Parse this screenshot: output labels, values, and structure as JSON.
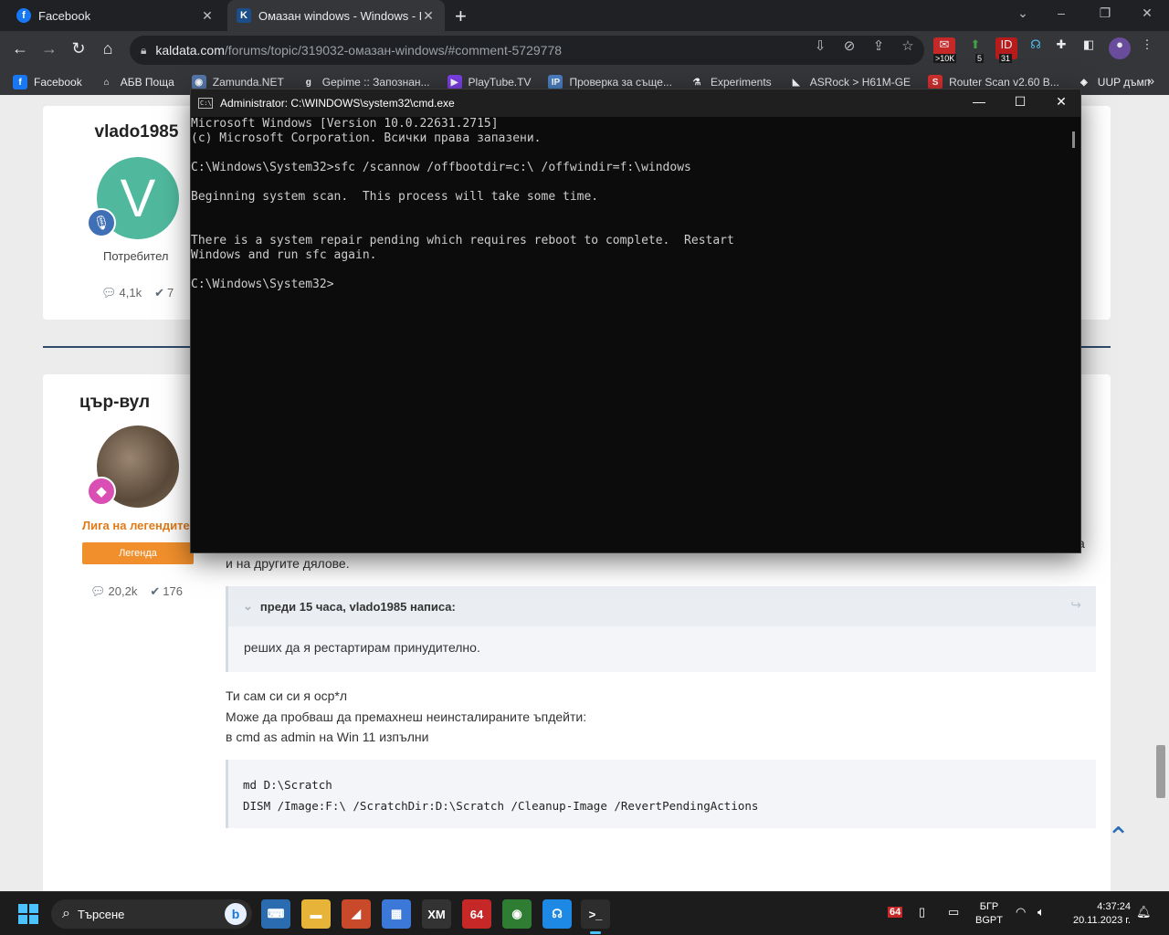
{
  "browser": {
    "tabs": [
      {
        "title": "Facebook",
        "active": false
      },
      {
        "title": "Омазан windows - Windows - K",
        "active": true
      }
    ],
    "url_host": "kaldata.com",
    "url_path": "/forums/topic/319032-омазан-windows/#comment-5729778",
    "extensions": [
      {
        "name": "mail-extension-icon",
        "badge": ">10K"
      },
      {
        "name": "green-extension-icon",
        "badge": "5"
      },
      {
        "name": "red-extension-icon",
        "badge": "31"
      }
    ],
    "bookmarks": [
      {
        "label": "Facebook",
        "color": "#1877f2",
        "glyph": "f"
      },
      {
        "label": "АБВ Поща",
        "color": "#35363a",
        "glyph": "⌂"
      },
      {
        "label": "Zamunda.NET",
        "color": "#5577aa",
        "glyph": "◉"
      },
      {
        "label": "Gepime :: Запознан...",
        "color": "#35363a",
        "glyph": "g"
      },
      {
        "label": "PlayTube.TV",
        "color": "#7b3fe4",
        "glyph": "▶"
      },
      {
        "label": "Проверка за съще...",
        "color": "#4a7fc1",
        "glyph": "IP"
      },
      {
        "label": "Experiments",
        "color": "#35363a",
        "glyph": "⚗"
      },
      {
        "label": "ASRock > H61M-GE",
        "color": "#35363a",
        "glyph": "◣"
      },
      {
        "label": "Router Scan v2.60 B...",
        "color": "#d32f2f",
        "glyph": "S"
      },
      {
        "label": "UUP дъмп",
        "color": "#35363a",
        "glyph": "◈"
      }
    ]
  },
  "post1": {
    "username": "vlado1985",
    "avatar_letter": "V",
    "role": "Потребител",
    "posts": "4,1k",
    "reputation": "7"
  },
  "post2": {
    "username": "цър-вул",
    "rank_title": "Лига на легендите",
    "rank_button": "Легенда",
    "posts": "20,2k",
    "reputation": "176",
    "text_fragment_right": "а",
    "text_line1": "и на другите дялове.",
    "quote_header": "преди 15 часа, vlado1985 написа:",
    "quote_body": "реших да я рестартирам принудително.",
    "para1": "Ти сам си си я оср*л",
    "para2": "Може да пробваш да премахнеш неинсталираните ъпдейти:",
    "para3": "в cmd as admin на Win 11 изпълни",
    "code_line1": "md D:\\Scratch",
    "code_line2": "DISM /Image:F:\\ /ScratchDir:D:\\Scratch /Cleanup-Image /RevertPendingActions"
  },
  "cmd": {
    "title": "Administrator: C:\\WINDOWS\\system32\\cmd.exe",
    "lines": [
      "Microsoft Windows [Version 10.0.22631.2715]",
      "(c) Microsoft Corporation. Всички права запазени.",
      "",
      "C:\\Windows\\System32>sfc /scannow /offbootdir=c:\\ /offwindir=f:\\windows",
      "",
      "Beginning system scan.  This process will take some time.",
      "",
      "",
      "There is a system repair pending which requires reboot to complete.  Restart",
      "Windows and run sfc again.",
      "",
      "C:\\Windows\\System32>"
    ]
  },
  "taskbar": {
    "search_placeholder": "Търсене",
    "apps": [
      {
        "name": "control-panel-app",
        "glyph": "⌨",
        "color": "#2b6cb0"
      },
      {
        "name": "file-explorer-app",
        "glyph": "▬",
        "color": "#e8b339"
      },
      {
        "name": "ccleaner-app",
        "glyph": "◢",
        "color": "#c94a2a"
      },
      {
        "name": "store-app",
        "glyph": "▦",
        "color": "#3b78d8"
      },
      {
        "name": "xmplay-app",
        "glyph": "XM",
        "color": "#333333"
      },
      {
        "name": "total-commander-app",
        "glyph": "64",
        "color": "#c62828"
      },
      {
        "name": "chrome-app",
        "glyph": "◉",
        "color": "#2e7d32"
      },
      {
        "name": "headset-app",
        "glyph": "☊",
        "color": "#1e88e5"
      },
      {
        "name": "terminal-app",
        "glyph": ">_",
        "color": "#2d2d2d"
      }
    ],
    "tray_badge": "64",
    "lang_top": "БГР",
    "lang_bottom": "BGPT",
    "time": "4:37:24",
    "date": "20.11.2023 г."
  }
}
